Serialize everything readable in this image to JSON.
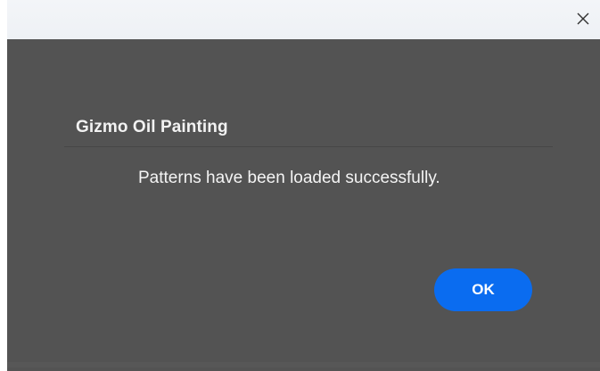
{
  "window": {
    "close_icon": "close-icon"
  },
  "dialog": {
    "title": "Gizmo Oil Painting",
    "message": "Patterns have been loaded successfully.",
    "ok_label": "OK"
  },
  "colors": {
    "panel_background": "#535353",
    "accent": "#0a6cf0",
    "text": "#f2f2f2"
  }
}
